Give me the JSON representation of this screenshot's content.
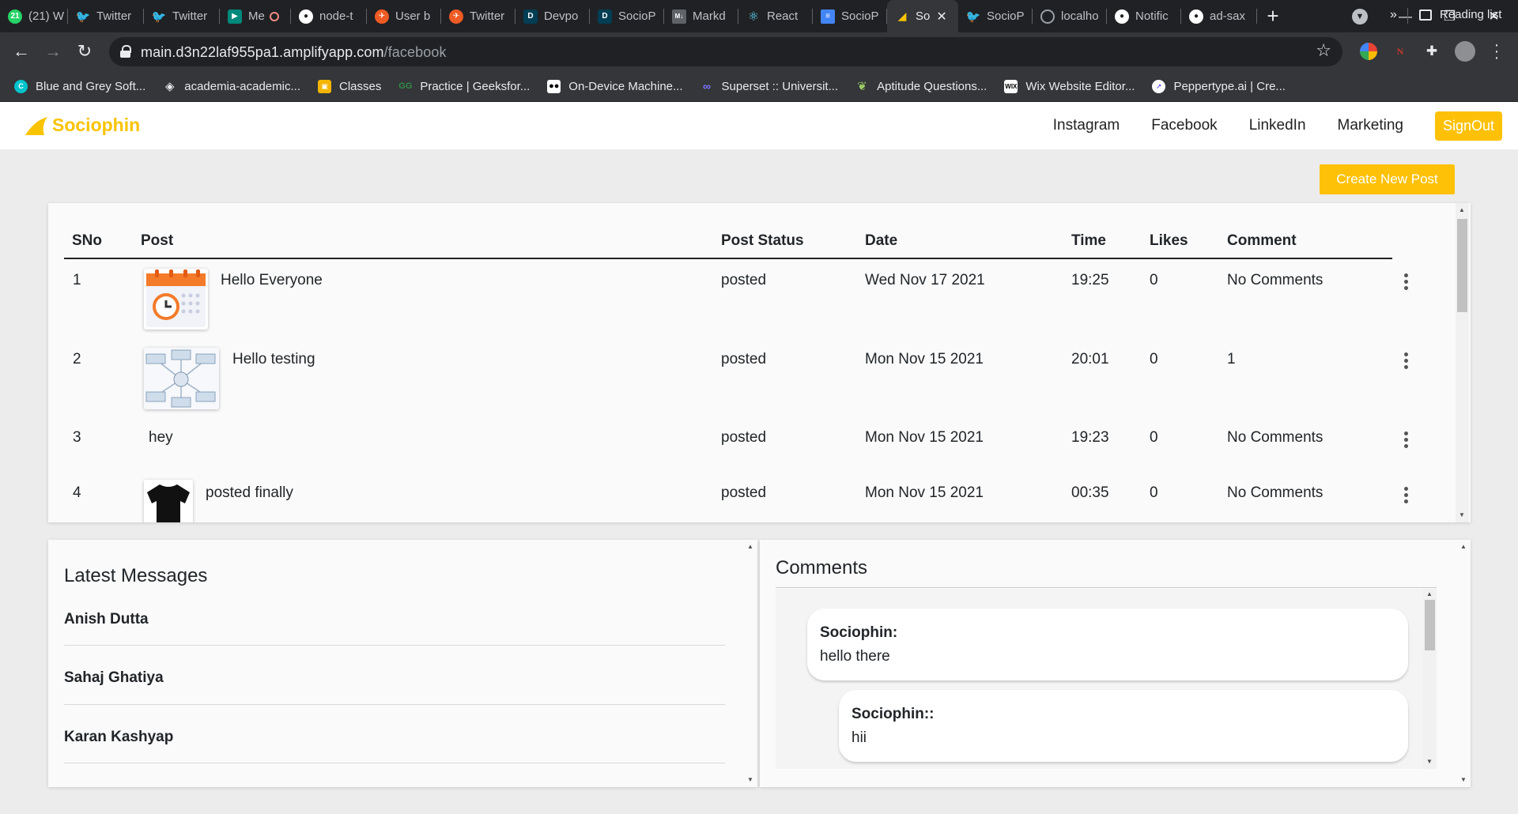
{
  "browser": {
    "tabs": [
      {
        "label": "(21) W",
        "icon": "whatsapp-icon",
        "color": "#25d366"
      },
      {
        "label": "Twitter",
        "icon": "twitter-icon",
        "color": "#1d9bf0"
      },
      {
        "label": "Twitter",
        "icon": "twitter-icon",
        "color": "#1d9bf0"
      },
      {
        "label": "Me",
        "icon": "google-meet-icon",
        "color": "#00897b"
      },
      {
        "label": "node-t",
        "icon": "github-icon",
        "color": "#ffffff"
      },
      {
        "label": "User b",
        "icon": "postman-icon",
        "color": "#ef5b25"
      },
      {
        "label": "Twitter",
        "icon": "postman-icon",
        "color": "#ef5b25"
      },
      {
        "label": "Devpo",
        "icon": "devpost-icon",
        "color": "#003e54"
      },
      {
        "label": "SocioP",
        "icon": "devpost-icon",
        "color": "#003e54"
      },
      {
        "label": "Markd",
        "icon": "markdown-icon",
        "color": "#5f6368"
      },
      {
        "label": "React",
        "icon": "react-icon",
        "color": "#61dafb"
      },
      {
        "label": "SocioP",
        "icon": "google-docs-icon",
        "color": "#4285f4"
      },
      {
        "label": "So",
        "icon": "sociophin-icon",
        "color": "#f9c300",
        "active": true
      },
      {
        "label": "SocioP",
        "icon": "twitter-icon",
        "color": "#1d9bf0"
      },
      {
        "label": "localho",
        "icon": "globe-icon",
        "color": "#9aa0a6"
      },
      {
        "label": "Notific",
        "icon": "github-icon",
        "color": "#ffffff"
      },
      {
        "label": "ad-sax",
        "icon": "github-icon",
        "color": "#ffffff"
      }
    ],
    "url_host": "main.d3n22laf955pa1.amplifyapp.com",
    "url_path": "/facebook",
    "bookmarks": [
      {
        "label": "Blue and Grey Soft...",
        "icon": "canva-icon",
        "color": "#00c4cc"
      },
      {
        "label": "academia-academic...",
        "icon": "diamond-icon",
        "color": "#5f6368"
      },
      {
        "label": "Classes",
        "icon": "google-classroom-icon",
        "color": "#f4b400"
      },
      {
        "label": "Practice | Geeksfor...",
        "icon": "geeksforgeeks-icon",
        "color": "#2f8d46"
      },
      {
        "label": "On-Device Machine...",
        "icon": "medium-icon",
        "color": "#000000"
      },
      {
        "label": "Superset :: Universit...",
        "icon": "superset-icon",
        "color": "#5a55d6"
      },
      {
        "label": "Aptitude Questions...",
        "icon": "leaf-icon",
        "color": "#7cb342"
      },
      {
        "label": "Wix Website Editor...",
        "icon": "wix-icon",
        "color": "#000000"
      },
      {
        "label": "Peppertype.ai | Cre...",
        "icon": "peppertype-icon",
        "color": "#4b3bff"
      }
    ],
    "bookmarks_more": "»",
    "reading_list": "Reading list"
  },
  "app": {
    "brand": "Sociophin",
    "brand_color": "#f9c300",
    "accent_color": "#ffc107",
    "nav": [
      "Instagram",
      "Facebook",
      "LinkedIn",
      "Marketing"
    ],
    "signout": "SignOut",
    "create_post": "Create New Post"
  },
  "posts_table": {
    "headers": [
      "SNo",
      "Post",
      "Post Status",
      "Date",
      "Time",
      "Likes",
      "Comment"
    ],
    "rows": [
      {
        "sno": "1",
        "post": "Hello Everyone",
        "thumb": "calendar-clock-image",
        "status": "posted",
        "date": "Wed Nov 17 2021",
        "time": "19:25",
        "likes": "0",
        "comment": "No Comments"
      },
      {
        "sno": "2",
        "post": "Hello testing",
        "thumb": "mindmap-diagram-image",
        "status": "posted",
        "date": "Mon Nov 15 2021",
        "time": "20:01",
        "likes": "0",
        "comment": "1"
      },
      {
        "sno": "3",
        "post": "hey",
        "thumb": "",
        "status": "posted",
        "date": "Mon Nov 15 2021",
        "time": "19:23",
        "likes": "0",
        "comment": "No Comments"
      },
      {
        "sno": "4",
        "post": "posted finally",
        "thumb": "black-tshirt-image",
        "status": "posted",
        "date": "Mon Nov 15 2021",
        "time": "00:35",
        "likes": "0",
        "comment": "No Comments"
      }
    ]
  },
  "messages": {
    "title": "Latest Messages",
    "items": [
      "Anish Dutta",
      "Sahaj Ghatiya",
      "Karan Kashyap"
    ]
  },
  "comments": {
    "title": "Comments",
    "items": [
      {
        "author": "Sociophin:",
        "text": "hello there"
      },
      {
        "author": "Sociophin::",
        "text": "hii"
      }
    ]
  }
}
